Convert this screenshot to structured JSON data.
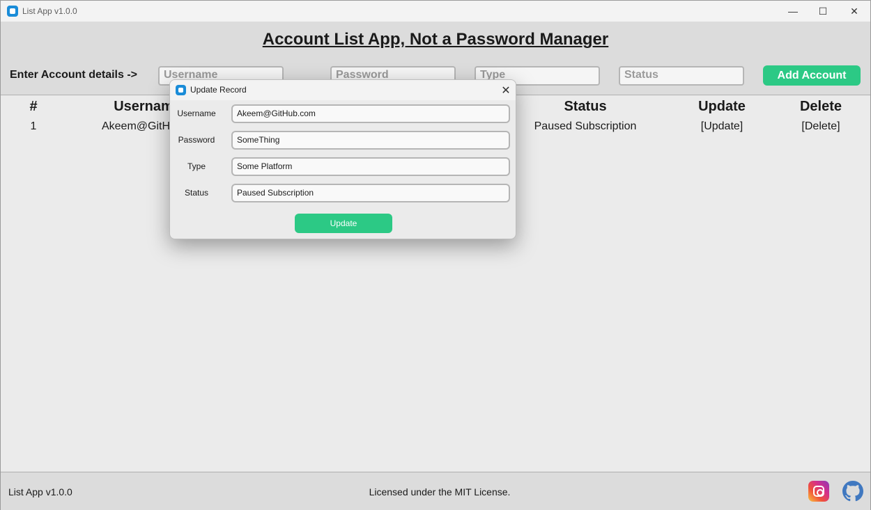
{
  "window": {
    "title": "List App v1.0.0",
    "controls": {
      "minimize": "—",
      "maximize": "☐",
      "close": "✕"
    }
  },
  "header": {
    "title": "Account List App, Not a Password Manager",
    "enter_label": "Enter Account details ->",
    "inputs": {
      "username_placeholder": "Username",
      "password_placeholder": "Password",
      "type_placeholder": "Type",
      "status_placeholder": "Status"
    },
    "add_button": "Add Account"
  },
  "table": {
    "columns": {
      "index": "#",
      "username": "Usernam",
      "status": "Status",
      "update": "Update",
      "delete": "Delete"
    },
    "rows": [
      {
        "index": "1",
        "username": "Akeem@GitH",
        "status": "Paused Subscription",
        "update": "[Update]",
        "delete": "[Delete]"
      }
    ]
  },
  "dialog": {
    "title": "Update Record",
    "close": "✕",
    "fields": {
      "username_label": "Username",
      "username_value": "Akeem@GitHub.com",
      "password_label": "Password",
      "password_value": "SomeThing",
      "type_label": "Type",
      "type_value": "Some Platform",
      "status_label": "Status",
      "status_value": "Paused Subscription"
    },
    "update_button": "Update"
  },
  "footer": {
    "version": "List App v1.0.0",
    "license": "Licensed under the MIT License.",
    "icons": [
      "instagram-icon",
      "github-icon"
    ]
  },
  "colors": {
    "accent": "#2cc985",
    "app_icon": "#1a8cd8"
  }
}
